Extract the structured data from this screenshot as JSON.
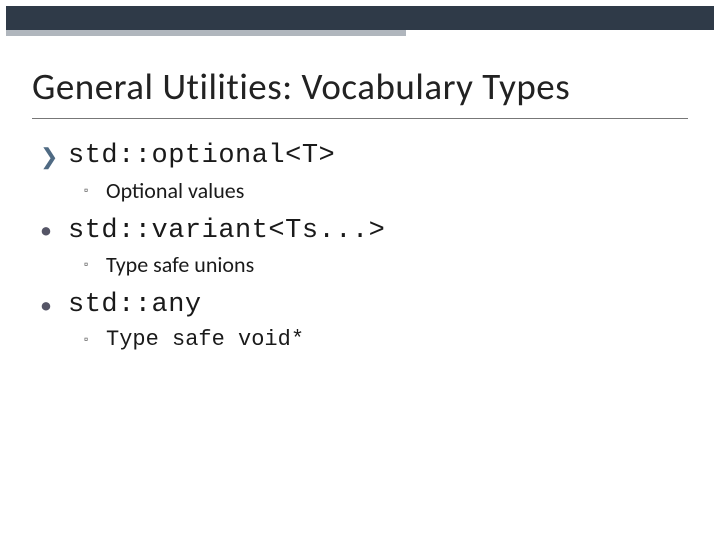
{
  "title": "General Utilities: Vocabulary Types",
  "items": [
    {
      "marker": "chev",
      "label": "std::optional<T>",
      "sub": {
        "text": "Optional values",
        "mono": false
      }
    },
    {
      "marker": "dot",
      "label": "std::variant<Ts...>",
      "sub": {
        "text": "Type safe unions",
        "mono": false
      }
    },
    {
      "marker": "dot",
      "label": "std::any",
      "sub": {
        "text": "Type safe void*",
        "mono": true
      }
    }
  ]
}
